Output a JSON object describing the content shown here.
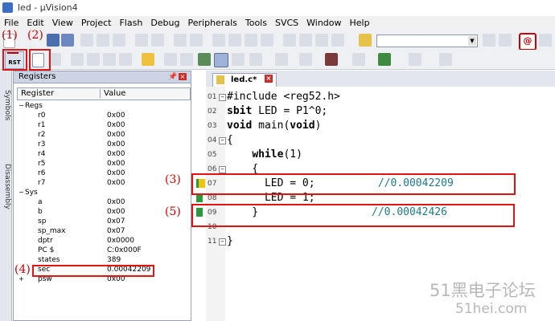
{
  "window": {
    "title": "led - µVision4"
  },
  "menu": [
    "File",
    "Edit",
    "View",
    "Project",
    "Flash",
    "Debug",
    "Peripherals",
    "Tools",
    "SVCS",
    "Window",
    "Help"
  ],
  "toolbar": {
    "rst_label": "RST"
  },
  "sidebar_tabs": {
    "symbols": "Symbols",
    "disassembly": "Disassembly"
  },
  "registers": {
    "title": "Registers",
    "col_register": "Register",
    "col_value": "Value",
    "rows": [
      {
        "name": "Regs",
        "value": "",
        "indent": 1,
        "toggle": "−"
      },
      {
        "name": "r0",
        "value": "0x00",
        "indent": 3
      },
      {
        "name": "r1",
        "value": "0x00",
        "indent": 3
      },
      {
        "name": "r2",
        "value": "0x00",
        "indent": 3
      },
      {
        "name": "r3",
        "value": "0x00",
        "indent": 3
      },
      {
        "name": "r4",
        "value": "0x00",
        "indent": 3
      },
      {
        "name": "r5",
        "value": "0x00",
        "indent": 3
      },
      {
        "name": "r6",
        "value": "0x00",
        "indent": 3
      },
      {
        "name": "r7",
        "value": "0x00",
        "indent": 3
      },
      {
        "name": "Sys",
        "value": "",
        "indent": 1,
        "toggle": "−"
      },
      {
        "name": "a",
        "value": "0x00",
        "indent": 3
      },
      {
        "name": "b",
        "value": "0x00",
        "indent": 3
      },
      {
        "name": "sp",
        "value": "0x07",
        "indent": 3
      },
      {
        "name": "sp_max",
        "value": "0x07",
        "indent": 3
      },
      {
        "name": "dptr",
        "value": "0x0000",
        "indent": 3
      },
      {
        "name": "PC  $",
        "value": "C:0x000F",
        "indent": 3
      },
      {
        "name": "states",
        "value": "389",
        "indent": 3
      },
      {
        "name": "sec",
        "value": "0.00042209",
        "indent": 3
      },
      {
        "name": "psw",
        "value": "0x00",
        "indent": 3,
        "toggle": "+"
      }
    ]
  },
  "editor": {
    "tab_label": "led.c*",
    "lines": [
      {
        "num": "01",
        "segs": [
          {
            "t": "#include <reg52.h>"
          }
        ],
        "fold": "−"
      },
      {
        "num": "02",
        "segs": [
          {
            "t": "sbit",
            "c": "kw"
          },
          {
            "t": " LED = P1^0;"
          }
        ]
      },
      {
        "num": "03",
        "segs": [
          {
            "t": "void",
            "c": "kw"
          },
          {
            "t": " main("
          },
          {
            "t": "void",
            "c": "kw"
          },
          {
            "t": ")"
          }
        ]
      },
      {
        "num": "04",
        "segs": [
          {
            "t": "{"
          }
        ],
        "fold": "−"
      },
      {
        "num": "05",
        "segs": [
          {
            "t": "    "
          },
          {
            "t": "while",
            "c": "kw"
          },
          {
            "t": "(1)"
          }
        ]
      },
      {
        "num": "06",
        "segs": [
          {
            "t": "    {"
          }
        ],
        "fold": "−"
      },
      {
        "num": "07",
        "segs": [
          {
            "t": "      LED = 0;"
          },
          {
            "t": "          //0.00042209",
            "c": "cm"
          }
        ],
        "marker": "arrow"
      },
      {
        "num": "08",
        "segs": [
          {
            "t": "      LED = 1;"
          }
        ],
        "marker": "bp"
      },
      {
        "num": "09",
        "segs": [
          {
            "t": "    }"
          },
          {
            "t": "                  //0.00042426",
            "c": "cm"
          }
        ],
        "marker": "bp"
      },
      {
        "num": "10",
        "segs": [
          {
            "t": ""
          }
        ]
      },
      {
        "num": "11",
        "segs": [
          {
            "t": "}"
          }
        ],
        "fold": "−"
      }
    ]
  },
  "annotations": {
    "a1": "(1)",
    "a2": "(2)",
    "a3": "(3)",
    "a4": "(4)",
    "a5": "(5)"
  },
  "watermark": {
    "line1": "51黑电子论坛",
    "line2": "51hei.com"
  }
}
